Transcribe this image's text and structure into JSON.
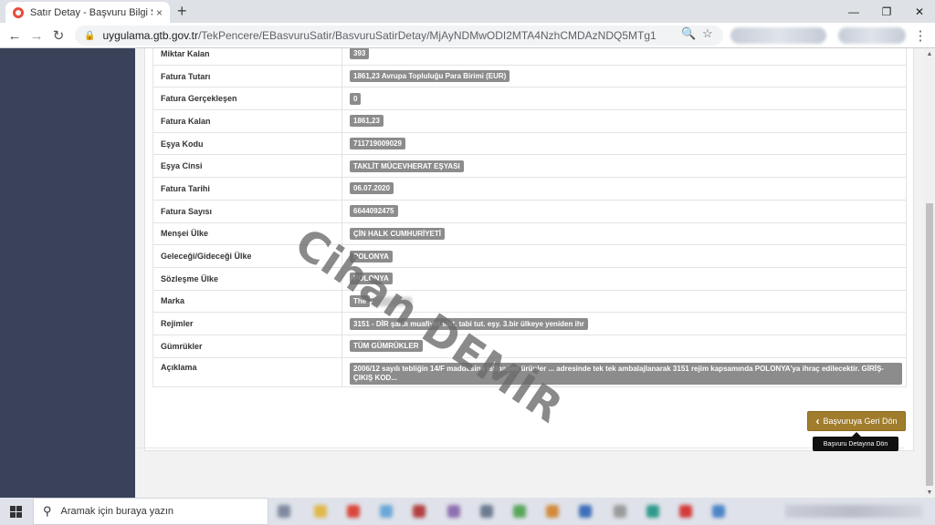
{
  "browser": {
    "tab_title": "Satır Detay - Başvuru Bilgi Sistem",
    "tab_close": "×",
    "new_tab": "+",
    "url_host": "uygulama.gtb.gov.tr",
    "url_path": "/TekPencere/EBasvuruSatir/BasvuruSatirDetay/MjAyNDMwODI2MTA4NzhCMDAzNDQ5MTg1",
    "icons": [
      "back-arrow-icon",
      "forward-arrow-icon",
      "reload-icon",
      "lock-icon",
      "zoom-icon",
      "star-icon"
    ]
  },
  "details": {
    "rows": [
      {
        "label": "Miktar Kalan",
        "value": "393"
      },
      {
        "label": "Fatura Tutarı",
        "value": "1861,23 Avrupa Topluluğu Para Birimi (EUR)"
      },
      {
        "label": "Fatura Gerçekleşen",
        "value": "0"
      },
      {
        "label": "Fatura Kalan",
        "value": "1861,23"
      },
      {
        "label": "Eşya Kodu",
        "value": "711719009029"
      },
      {
        "label": "Eşya Cinsi",
        "value": "TAKLİT MÜCEVHERAT EŞYASI"
      },
      {
        "label": "Fatura Tarihi",
        "value": "06.07.2020"
      },
      {
        "label": "Fatura Sayısı",
        "value": "6644092475"
      },
      {
        "label": "Menşei Ülke",
        "value": "ÇİN HALK CUMHURİYETİ"
      },
      {
        "label": "Geleceği/Gideceği Ülke",
        "value": "POLONYA"
      },
      {
        "label": "Sözleşme Ülke",
        "value": "POLONYA"
      },
      {
        "label": "Marka",
        "value": "The"
      },
      {
        "label": "Rejimler",
        "value": "3151 - DİR şartlı muafiyet sist. tabi tut. eşy. 3.bir ülkeye yeniden ihr"
      },
      {
        "label": "Gümrükler",
        "value": "TÜM GÜMRÜKLER"
      },
      {
        "label": "Açıklama",
        "value": "2006/12 sayılı tebliğin 14/F maddesine istinaden ürünler ... adresinde tek tek ambalajlanarak 3151 rejim kapsamında POLONYA'ya ihraç edilecektir. GİRİŞ-ÇIKIŞ KOD..."
      }
    ]
  },
  "actions": {
    "back_label": "Başvuruya Geri Dön",
    "back_tooltip": "Başvuru Detayına Dön"
  },
  "watermark": {
    "text": "Cihan DEMİR"
  },
  "taskbar": {
    "search_placeholder": "Aramak için buraya yazın"
  },
  "colors": {
    "sidebar": "#394259",
    "button": "#a07c2c",
    "pill": "#8c8c8c"
  }
}
